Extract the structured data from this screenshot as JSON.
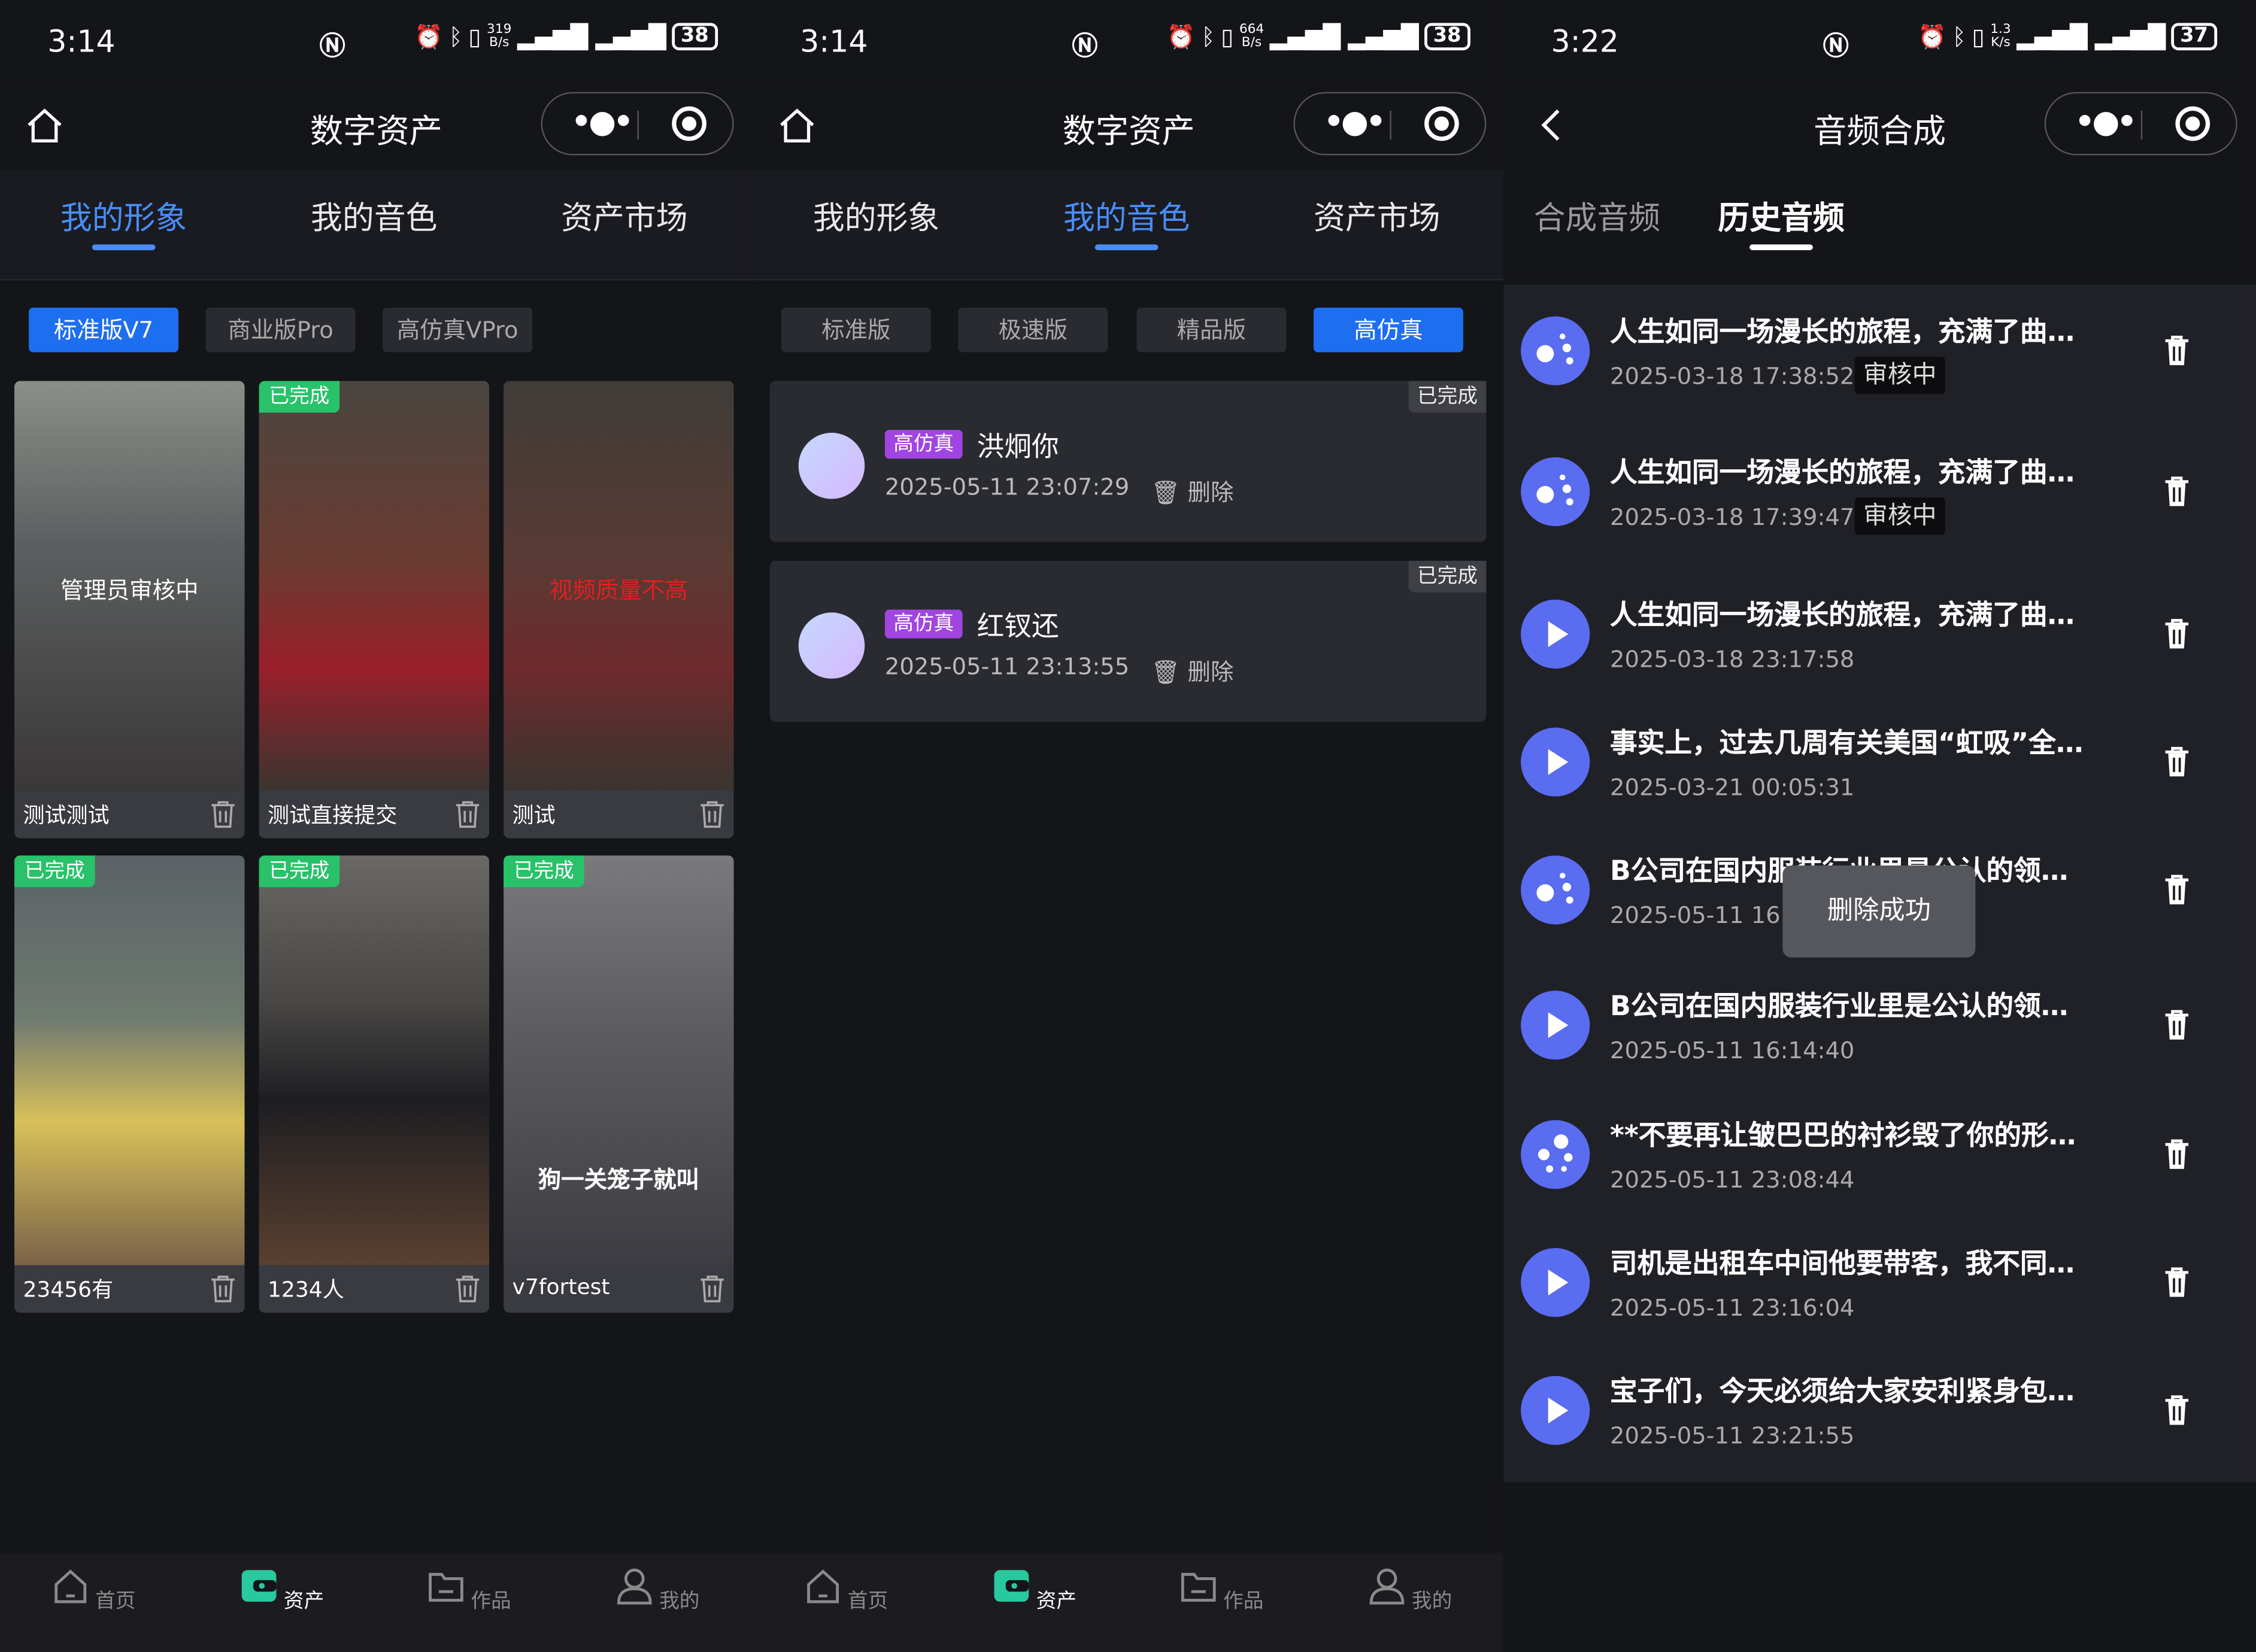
{
  "panels": [
    {
      "status": {
        "time": "3:14",
        "speed_top": "319",
        "speed_bot": "B/s",
        "battery": "38"
      },
      "nav_title": "数字资产",
      "tabs": [
        "我的形象",
        "我的音色",
        "资产市场"
      ],
      "chips": [
        "标准版V7",
        "商业版Pro",
        "高仿真VPro"
      ],
      "cards": [
        {
          "caption": "测试测试",
          "overlay": "管理员审核中",
          "badge": ""
        },
        {
          "caption": "测试直接提交",
          "overlay": "",
          "badge": "已完成"
        },
        {
          "caption": "测试",
          "overlay": "视频质量不高",
          "badge": ""
        },
        {
          "caption": "23456有",
          "overlay": "",
          "badge": "已完成"
        },
        {
          "caption": "1234人",
          "overlay": "",
          "badge": "已完成"
        },
        {
          "caption": "v7fortest",
          "overlay": "狗一关笼子就叫",
          "badge": "已完成"
        }
      ]
    },
    {
      "status": {
        "time": "3:14",
        "speed_top": "664",
        "speed_bot": "B/s",
        "battery": "38"
      },
      "nav_title": "数字资产",
      "tabs": [
        "我的形象",
        "我的音色",
        "资产市场"
      ],
      "chips": [
        "标准版",
        "极速版",
        "精品版",
        "高仿真"
      ],
      "voices": [
        {
          "tag": "高仿真",
          "name": "洪炯你",
          "time": "2025-05-11 23:07:29",
          "status": "已完成",
          "del": "删除"
        },
        {
          "tag": "高仿真",
          "name": "红钗还",
          "time": "2025-05-11 23:13:55",
          "status": "已完成",
          "del": "删除"
        }
      ]
    },
    {
      "status": {
        "time": "3:22",
        "speed_top": "1.3",
        "speed_bot": "K/s",
        "battery": "37"
      },
      "nav_title": "音频合成",
      "tabs": [
        "合成音频",
        "历史音频"
      ],
      "history": [
        {
          "title": "人生如同一场漫长的旅程，充满了曲…",
          "date": "2025-03-18 17:38:52",
          "status": "审核中",
          "icon": "processing-dots-icon"
        },
        {
          "title": "人生如同一场漫长的旅程，充满了曲…",
          "date": "2025-03-18 17:39:47",
          "status": "审核中",
          "icon": "processing-dots-icon"
        },
        {
          "title": "人生如同一场漫长的旅程，充满了曲…",
          "date": "2025-03-18 23:17:58",
          "status": "",
          "icon": "play-icon"
        },
        {
          "title": "事实上，过去几周有关美国“虹吸”全…",
          "date": "2025-03-21 00:05:31",
          "status": "",
          "icon": "play-icon"
        },
        {
          "title": "B公司在国内服装行业里是公认的领…",
          "date": "2025-05-11 16:",
          "status": "",
          "icon": "processing-dots-icon"
        },
        {
          "title": "B公司在国内服装行业里是公认的领…",
          "date": "2025-05-11 16:14:40",
          "status": "",
          "icon": "play-icon"
        },
        {
          "title": "**不要再让皱巴巴的衬衫毁了你的形…",
          "date": "2025-05-11 23:08:44",
          "status": "",
          "icon": "loading-dots-icon"
        },
        {
          "title": "司机是出租车中间他要带客，我不同…",
          "date": "2025-05-11 23:16:04",
          "status": "",
          "icon": "play-icon"
        },
        {
          "title": "宝子们，今天必须给大家安利紧身包…",
          "date": "2025-05-11 23:21:55",
          "status": "",
          "icon": "play-icon"
        }
      ],
      "toast": "删除成功"
    }
  ],
  "bottom_nav": [
    "首页",
    "资产",
    "作品",
    "我的"
  ],
  "colors": {
    "accent": "#4a8df8",
    "chip_active": "#1e6ef0",
    "done_badge": "#29c26a",
    "tag": "#a145e0",
    "bg": "#141519"
  }
}
